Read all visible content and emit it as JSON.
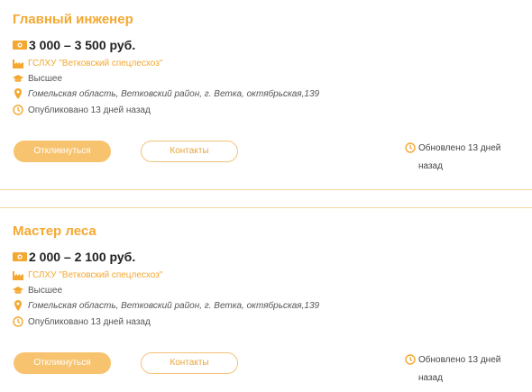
{
  "vacancies": [
    {
      "title": "Главный инженер",
      "salary": "3 000 – 3 500 руб.",
      "company": "ГСЛХУ \"Ветковский спецлесхоз\"",
      "education": "Высшее",
      "address": "Гомельская область, Ветковский район, г. Ветка, октябрьская,139",
      "published": "Опубликовано 13 дней назад",
      "apply_label": "Откликнуться",
      "contacts_label": "Контакты",
      "updated": "Обновлено 13 дней назад"
    },
    {
      "title": "Мастер леса",
      "salary": "2 000 – 2 100 руб.",
      "company": "ГСЛХУ \"Ветковский спецлесхоз\"",
      "education": "Высшее",
      "address": "Гомельская область, Ветковский район, г. Ветка, октябрьская,139",
      "published": "Опубликовано 13 дней назад",
      "apply_label": "Откликнуться",
      "contacts_label": "Контакты",
      "updated": "Обновлено 13 дней назад"
    }
  ],
  "icons": {
    "salary": "money-icon",
    "company": "factory-icon",
    "education": "graduation-cap-icon",
    "address": "location-pin-icon",
    "time": "clock-icon"
  },
  "colors": {
    "accent": "#F4A830",
    "button_fill": "#F8C36F",
    "separator": "#F3D7A4"
  }
}
